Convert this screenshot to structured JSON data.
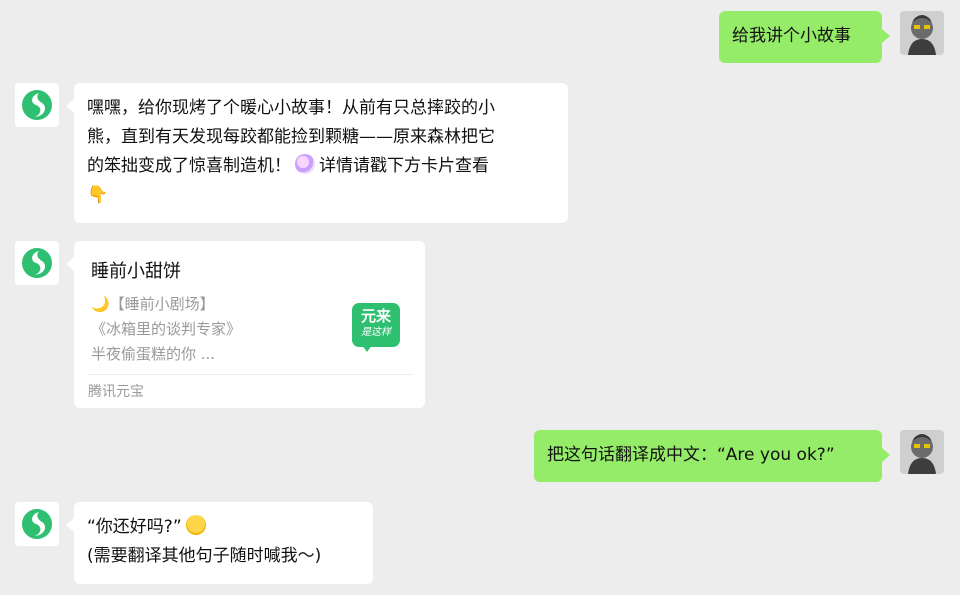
{
  "colors": {
    "background": "#ededed",
    "user_bubble": "#95ec69",
    "bot_bubble": "#ffffff",
    "bot_brand": "#2fbf71"
  },
  "messages": {
    "m1_user": "给我讲个小故事",
    "m2_bot_line1": "嘿嘿，给你现烤了个暖心小故事！从前有只总摔跤的小",
    "m2_bot_line2": "熊，直到有天发现每跤都能捡到颗糖——原来森林把它",
    "m2_bot_line3": "的笨拙变成了惊喜制造机！",
    "m2_bot_line3_tail": "详情请戳下方卡片查看",
    "m2_bot_emoji_candy": "candy-emoji",
    "m2_bot_emoji_point": "👇",
    "m4_user": "把这句话翻译成中文：“Are you ok?”",
    "m5_bot_line1": "“你还好吗?”",
    "m5_bot_emoji": "smiling-face-emoji",
    "m5_bot_line2": "(需要翻译其他句子随时喊我～)"
  },
  "card": {
    "title": "睡前小甜饼",
    "line1": "🌙【睡前小剧场】",
    "line2": "《冰箱里的谈判专家》",
    "line3": "半夜偷蛋糕的你 ...",
    "badge_line1": "元来",
    "badge_line2": "是这样",
    "source": "腾讯元宝"
  },
  "icons": {
    "bot_avatar": "yuanbao-logo-icon",
    "user_avatar": "user-photo-avatar"
  }
}
